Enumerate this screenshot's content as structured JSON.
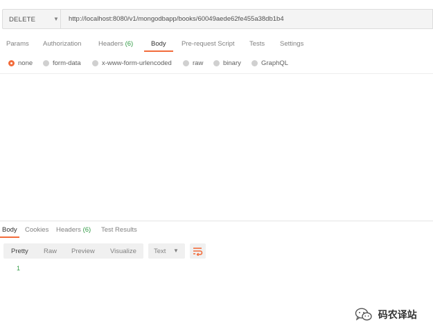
{
  "request": {
    "method": "DELETE",
    "url": "http://localhost:8080/v1/mongodbapp/books/60049aede62fe455a38db1b4"
  },
  "request_tabs": [
    {
      "label": "Params",
      "count": ""
    },
    {
      "label": "Authorization",
      "count": ""
    },
    {
      "label": "Headers",
      "count": "(6)"
    },
    {
      "label": "Body",
      "count": ""
    },
    {
      "label": "Pre-request Script",
      "count": ""
    },
    {
      "label": "Tests",
      "count": ""
    },
    {
      "label": "Settings",
      "count": ""
    }
  ],
  "active_request_tab": "Body",
  "body_types": [
    {
      "label": "none",
      "selected": true
    },
    {
      "label": "form-data",
      "selected": false
    },
    {
      "label": "x-www-form-urlencoded",
      "selected": false
    },
    {
      "label": "raw",
      "selected": false
    },
    {
      "label": "binary",
      "selected": false
    },
    {
      "label": "GraphQL",
      "selected": false
    }
  ],
  "response_tabs": [
    {
      "label": "Body",
      "count": ""
    },
    {
      "label": "Cookies",
      "count": ""
    },
    {
      "label": "Headers",
      "count": "(6)"
    },
    {
      "label": "Test Results",
      "count": ""
    }
  ],
  "active_response_tab": "Body",
  "response_view_modes": [
    "Pretty",
    "Raw",
    "Preview",
    "Visualize"
  ],
  "active_view_mode": "Pretty",
  "response_format": "Text",
  "response_lines": [
    "1"
  ],
  "watermark": {
    "text": "码农译站",
    "icon": "wechat-icon"
  },
  "colors": {
    "accent": "#f26b3a",
    "count": "#2f9a43",
    "line_number": "#2f9a43"
  }
}
